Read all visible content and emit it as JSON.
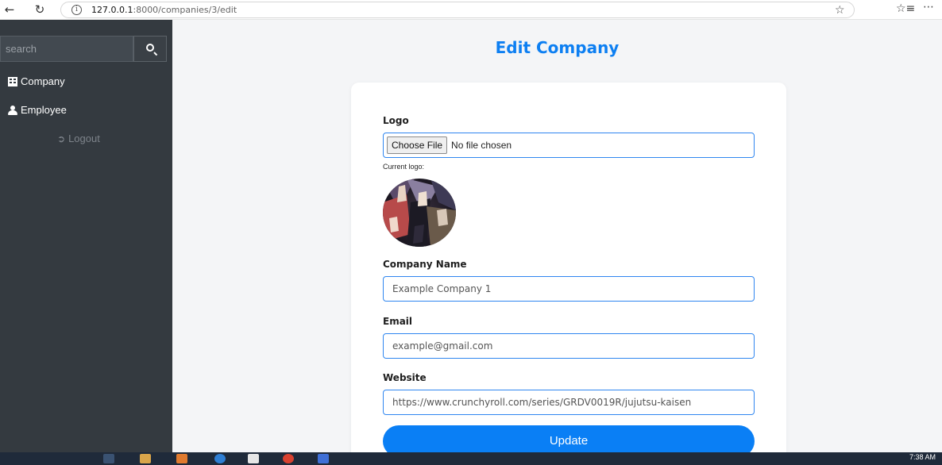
{
  "browser": {
    "url_host": "127.0.0.1",
    "url_path": ":8000/companies/3/edit"
  },
  "sidebar": {
    "search_placeholder": "search",
    "items": [
      {
        "label": "Company",
        "icon": "building-icon"
      },
      {
        "label": "Employee",
        "icon": "users-icon"
      }
    ],
    "logout_label": "Logout"
  },
  "page": {
    "title": "Edit Company"
  },
  "form": {
    "logo_label": "Logo",
    "choose_file_label": "Choose File",
    "no_file_text": "No file chosen",
    "current_logo_label": "Current logo:",
    "company_name_label": "Company Name",
    "company_name_value": "Example Company 1",
    "email_label": "Email",
    "email_value": "example@gmail.com",
    "website_label": "Website",
    "website_value": "https://www.crunchyroll.com/series/GRDV0019R/jujutsu-kaisen",
    "submit_label": "Update"
  },
  "taskbar": {
    "time": "7:38 AM"
  },
  "colors": {
    "accent": "#0a7ff5",
    "sidebar_bg": "#343a40"
  }
}
